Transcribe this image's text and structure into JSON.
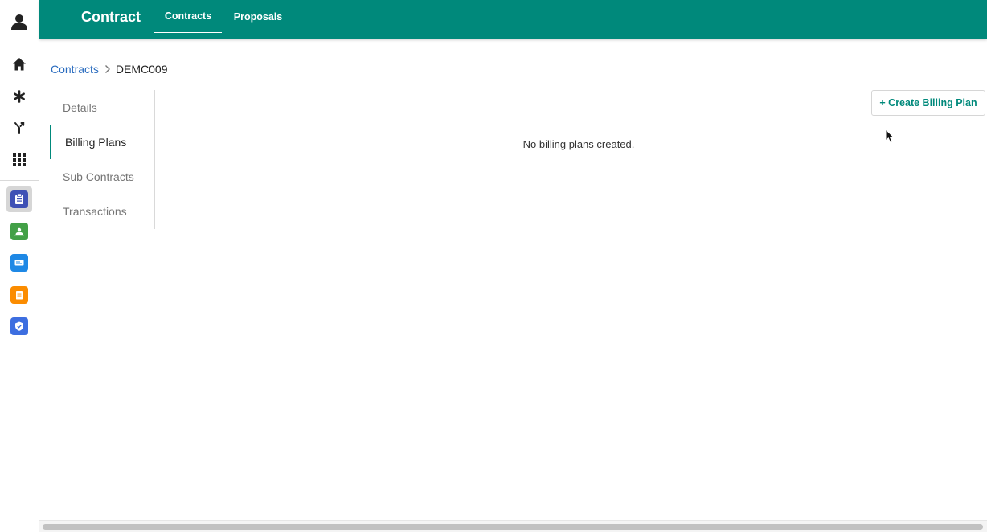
{
  "header": {
    "app_title": "Contract",
    "tabs": [
      {
        "label": "Contracts",
        "active": true
      },
      {
        "label": "Proposals",
        "active": false
      }
    ]
  },
  "breadcrumb": {
    "parent": "Contracts",
    "current": "DEMC009"
  },
  "side_tabs": [
    {
      "label": "Details",
      "active": false
    },
    {
      "label": "Billing Plans",
      "active": true
    },
    {
      "label": "Sub Contracts",
      "active": false
    },
    {
      "label": "Transactions",
      "active": false
    }
  ],
  "main": {
    "create_button_label": "+ Create Billing Plan",
    "empty_message": "No billing plans created."
  },
  "rail": {
    "nav_icons": [
      "user-icon",
      "home-icon",
      "asterisk-icon",
      "merge-icon",
      "apps-grid-icon"
    ],
    "apps": [
      {
        "icon": "clipboard-icon",
        "color": "#3f51b5",
        "selected": true
      },
      {
        "icon": "team-icon",
        "color": "#43a047",
        "selected": false
      },
      {
        "icon": "ticket-icon",
        "color": "#1e88e5",
        "selected": false
      },
      {
        "icon": "notepad-icon",
        "color": "#fb8c00",
        "selected": false
      },
      {
        "icon": "shield-icon",
        "color": "#3d6ee0",
        "selected": false
      }
    ]
  },
  "colors": {
    "brand": "#00897b",
    "link": "#2a6cbf"
  }
}
